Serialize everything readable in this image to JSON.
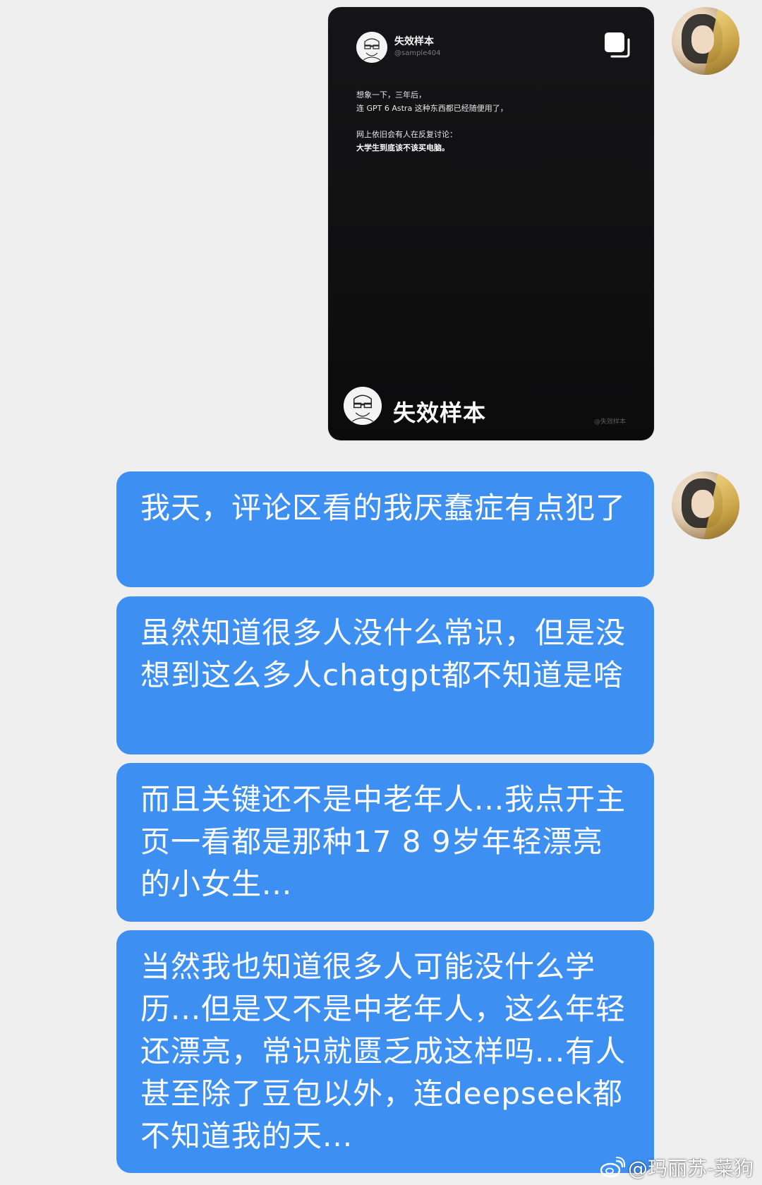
{
  "shared_card": {
    "author_name": "失效样本",
    "author_handle": "@sample404",
    "lines": [
      "想象一下，三年后，",
      "连 GPT 6 Astra 这种东西都已经随便用了，",
      "网上依旧会有人在反复讨论：",
      "大学生到底该不该买电脑。"
    ],
    "footer_name": "失效样本",
    "watermark": "@失效样本"
  },
  "messages": [
    {
      "text": "我天，评论区看的我厌蠢症有点犯了"
    },
    {
      "text": "虽然知道很多人没什么常识，但是没想到这么多人chatgpt都不知道是啥"
    },
    {
      "text": "而且关键还不是中老年人...我点开主页一看都是那种17 8 9岁年轻漂亮的小女生..."
    },
    {
      "text": "当然我也知道很多人可能没什么学历...但是又不是中老年人，这么年轻还漂亮，常识就匮乏成这样吗...有人甚至除了豆包以外，连deepseek都不知道我的天..."
    }
  ],
  "watermark": {
    "text": "@玛丽苏-菜狗"
  },
  "colors": {
    "bubble": "#3d8ff2",
    "background": "#efefef",
    "card": "#121213"
  }
}
